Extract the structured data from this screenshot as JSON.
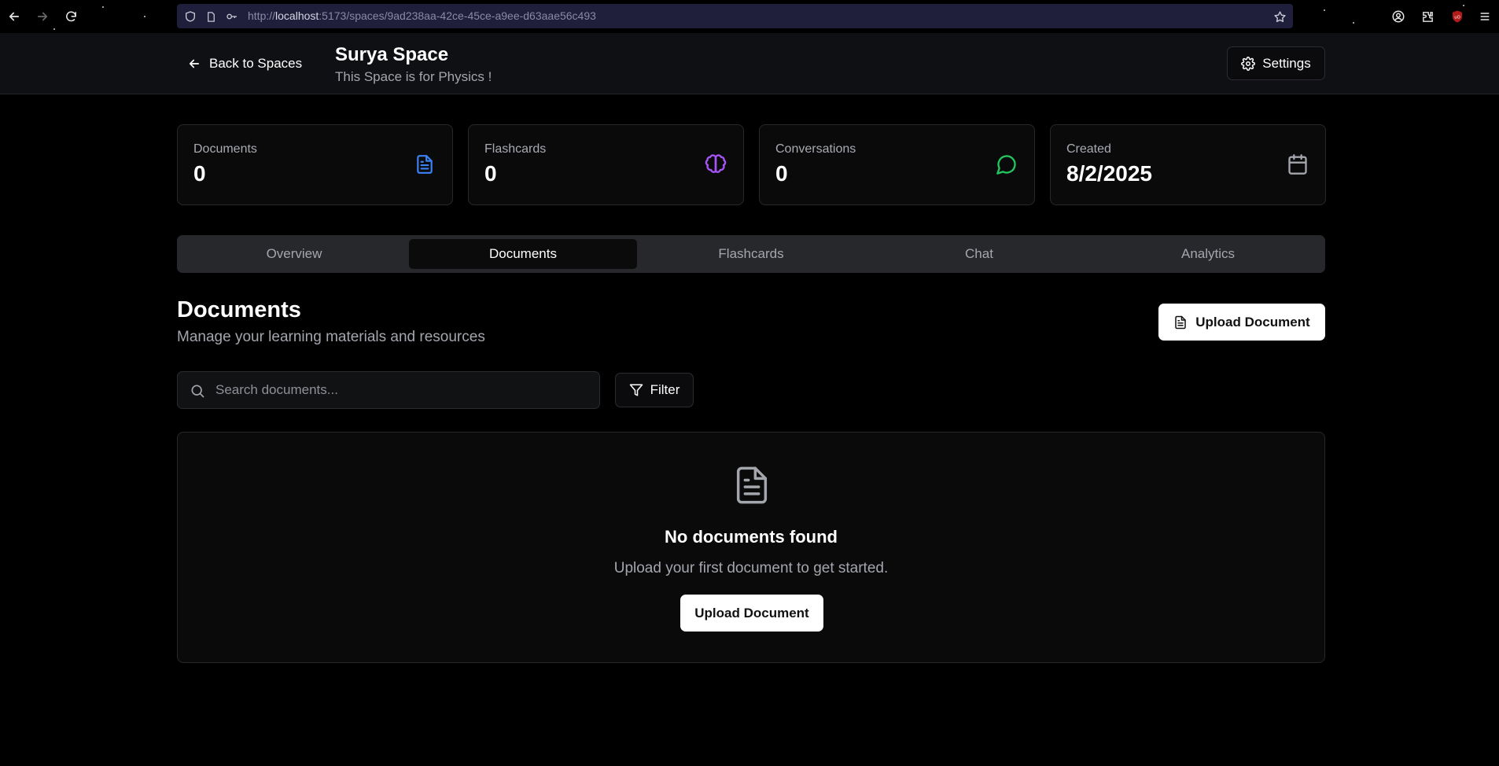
{
  "browser": {
    "url_prefix": "http://",
    "url_host": "localhost",
    "url_rest": ":5173/spaces/9ad238aa-42ce-45ce-a9ee-d63aae56c493",
    "icons": [
      "back-arrow-icon",
      "forward-arrow-icon",
      "reload-icon",
      "shield-icon",
      "page-icon",
      "key-icon",
      "bookmark-star-icon",
      "account-icon",
      "extensions-icon",
      "ublock-icon",
      "menu-icon"
    ]
  },
  "header": {
    "back_label": "Back to Spaces",
    "title": "Surya Space",
    "subtitle": "This Space is for Physics !",
    "settings_label": "Settings"
  },
  "stats": [
    {
      "label": "Documents",
      "value": "0",
      "icon": "document-icon",
      "color": "#3b82f6"
    },
    {
      "label": "Flashcards",
      "value": "0",
      "icon": "brain-icon",
      "color": "#a855f7"
    },
    {
      "label": "Conversations",
      "value": "0",
      "icon": "chat-bubble-icon",
      "color": "#22c55e"
    },
    {
      "label": "Created",
      "value": "8/2/2025",
      "icon": "calendar-icon",
      "color": "#a4a6ad"
    }
  ],
  "tabs": [
    {
      "label": "Overview",
      "active": false
    },
    {
      "label": "Documents",
      "active": true
    },
    {
      "label": "Flashcards",
      "active": false
    },
    {
      "label": "Chat",
      "active": false
    },
    {
      "label": "Analytics",
      "active": false
    }
  ],
  "documents": {
    "title": "Documents",
    "subtitle": "Manage your learning materials and resources",
    "upload_label": "Upload Document",
    "search_placeholder": "Search documents...",
    "search_value": "",
    "filter_label": "Filter"
  },
  "empty_state": {
    "title": "No documents found",
    "subtitle": "Upload your first document to get started.",
    "button_label": "Upload Document"
  }
}
